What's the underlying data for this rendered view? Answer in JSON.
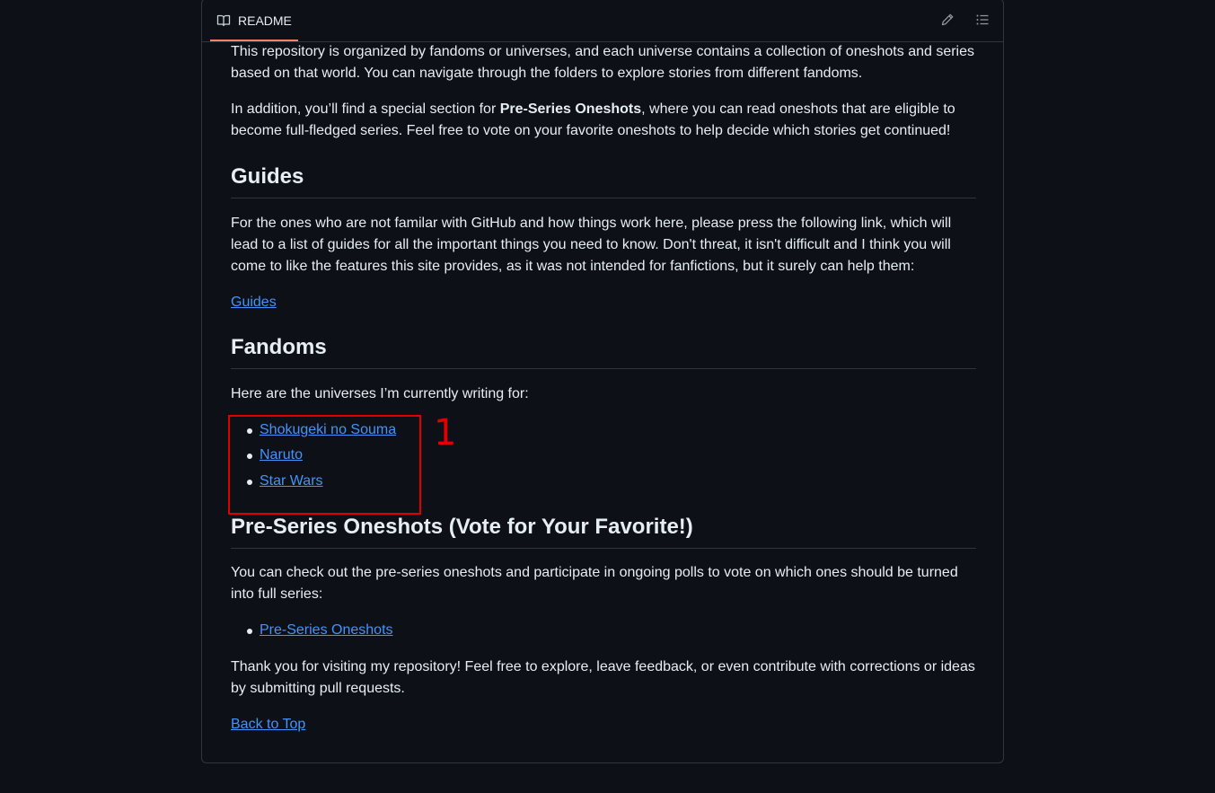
{
  "tab": {
    "label": "README"
  },
  "toolbar": {
    "edit_icon": "pencil-icon",
    "outline_icon": "list-unordered-icon"
  },
  "intro": {
    "p1": "This repository is organized by fandoms or universes, and each universe contains a collection of oneshots and series based on that world. You can navigate through the folders to explore stories from different fandoms.",
    "p2_before": "In addition, you’ll find a special section for ",
    "p2_bold": "Pre-Series Oneshots",
    "p2_after": ", where you can read oneshots that are eligible to become full-fledged series. Feel free to vote on your favorite oneshots to help decide which stories get continued!"
  },
  "guides": {
    "heading": "Guides",
    "text": "For the ones who are not familar with GitHub and how things work here, please press the following link, which will lead to a list of guides for all the important things you need to know. Don't threat, it isn't difficult and I think you will come to like the features this site provides, as it was not intended for fanfictions, but it surely can help them:",
    "link": "Guides"
  },
  "fandoms": {
    "heading": "Fandoms",
    "text": "Here are the universes I’m currently writing for:",
    "items": [
      "Shokugeki no Souma",
      "Naruto",
      "Star Wars"
    ]
  },
  "preseries": {
    "heading": "Pre-Series Oneshots (Vote for Your Favorite!)",
    "text": "You can check out the pre-series oneshots and participate in ongoing polls to vote on which ones should be turned into full series:",
    "items": [
      "Pre-Series Oneshots"
    ]
  },
  "closing": {
    "text": "Thank you for visiting my repository! Feel free to explore, leave feedback, or even contribute with corrections or ideas by submitting pull requests.",
    "back_link": "Back to Top"
  },
  "annotation": {
    "number": "1",
    "color": "#e00000"
  },
  "colors": {
    "link": "#4493f8",
    "tab_underline": "#f78166",
    "background": "#0d1117"
  }
}
